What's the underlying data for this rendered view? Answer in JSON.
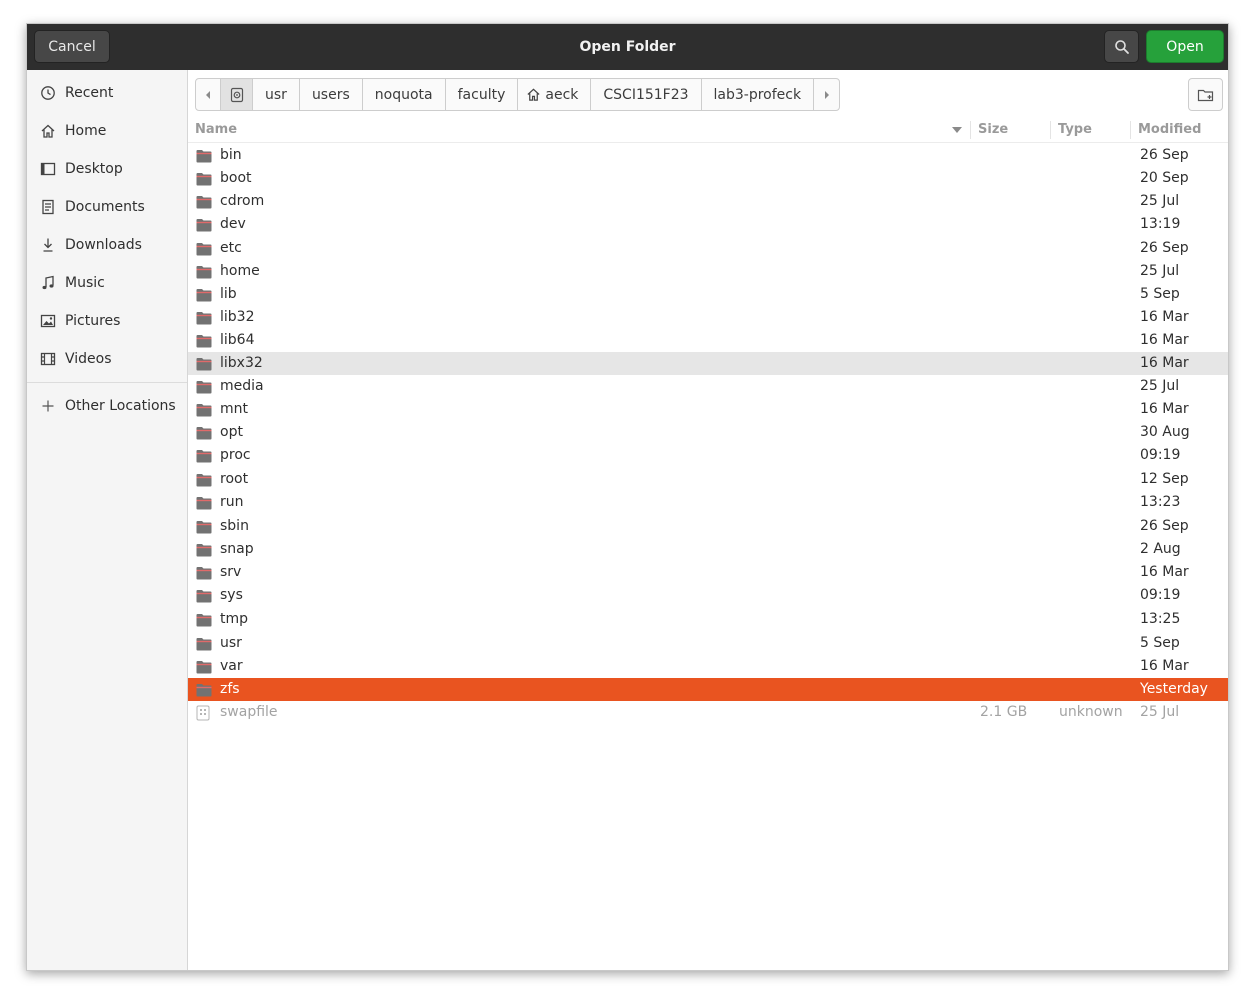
{
  "dialog": {
    "title": "Open Folder",
    "cancel_label": "Cancel",
    "open_label": "Open"
  },
  "sidebar": {
    "items": [
      {
        "label": "Recent",
        "icon": "clock-icon"
      },
      {
        "label": "Home",
        "icon": "home-icon"
      },
      {
        "label": "Desktop",
        "icon": "desktop-icon"
      },
      {
        "label": "Documents",
        "icon": "document-icon"
      },
      {
        "label": "Downloads",
        "icon": "download-icon"
      },
      {
        "label": "Music",
        "icon": "music-note-icon"
      },
      {
        "label": "Pictures",
        "icon": "picture-icon"
      },
      {
        "label": "Videos",
        "icon": "film-icon"
      }
    ],
    "other_locations": {
      "label": "Other Locations",
      "icon": "plus-icon"
    }
  },
  "pathbar": {
    "crumbs": [
      "usr",
      "users",
      "noquota",
      "faculty",
      "aeck",
      "CSCI151F23",
      "lab3-profeck"
    ]
  },
  "columns": {
    "name": "Name",
    "size": "Size",
    "type": "Type",
    "modified": "Modified"
  },
  "files": [
    {
      "name": "bin",
      "size": "",
      "type": "",
      "modified": "26 Sep"
    },
    {
      "name": "boot",
      "size": "",
      "type": "",
      "modified": "20 Sep"
    },
    {
      "name": "cdrom",
      "size": "",
      "type": "",
      "modified": "25 Jul"
    },
    {
      "name": "dev",
      "size": "",
      "type": "",
      "modified": "13:19"
    },
    {
      "name": "etc",
      "size": "",
      "type": "",
      "modified": "26 Sep"
    },
    {
      "name": "home",
      "size": "",
      "type": "",
      "modified": "25 Jul"
    },
    {
      "name": "lib",
      "size": "",
      "type": "",
      "modified": "5 Sep"
    },
    {
      "name": "lib32",
      "size": "",
      "type": "",
      "modified": "16 Mar"
    },
    {
      "name": "lib64",
      "size": "",
      "type": "",
      "modified": "16 Mar"
    },
    {
      "name": "libx32",
      "size": "",
      "type": "",
      "modified": "16 Mar"
    },
    {
      "name": "media",
      "size": "",
      "type": "",
      "modified": "25 Jul"
    },
    {
      "name": "mnt",
      "size": "",
      "type": "",
      "modified": "16 Mar"
    },
    {
      "name": "opt",
      "size": "",
      "type": "",
      "modified": "30 Aug"
    },
    {
      "name": "proc",
      "size": "",
      "type": "",
      "modified": "09:19"
    },
    {
      "name": "root",
      "size": "",
      "type": "",
      "modified": "12 Sep"
    },
    {
      "name": "run",
      "size": "",
      "type": "",
      "modified": "13:23"
    },
    {
      "name": "sbin",
      "size": "",
      "type": "",
      "modified": "26 Sep"
    },
    {
      "name": "snap",
      "size": "",
      "type": "",
      "modified": "2 Aug"
    },
    {
      "name": "srv",
      "size": "",
      "type": "",
      "modified": "16 Mar"
    },
    {
      "name": "sys",
      "size": "",
      "type": "",
      "modified": "09:19"
    },
    {
      "name": "tmp",
      "size": "",
      "type": "",
      "modified": "13:25"
    },
    {
      "name": "usr",
      "size": "",
      "type": "",
      "modified": "5 Sep"
    },
    {
      "name": "var",
      "size": "",
      "type": "",
      "modified": "16 Mar"
    },
    {
      "name": "zfs",
      "size": "",
      "type": "",
      "modified": "Yesterday"
    },
    {
      "name": "swapfile",
      "size": "2.1 GB",
      "type": "unknown",
      "modified": "25 Jul"
    }
  ],
  "state": {
    "hover_row": "libx32",
    "selected_row": "zfs",
    "dim_row": "swapfile"
  },
  "colors": {
    "titlebar": "#2e2e2e",
    "open_button": "#26a13b",
    "selection": "#e95420",
    "hover": "#e6e6e6"
  }
}
